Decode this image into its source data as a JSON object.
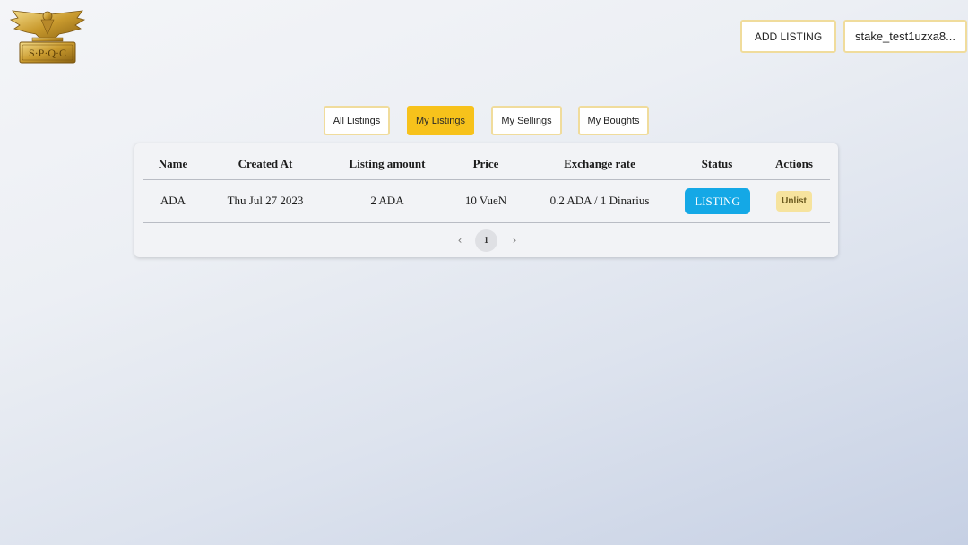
{
  "header": {
    "logo_text": "S·P·Q·C",
    "add_listing_label": "ADD LISTING",
    "wallet_label": "stake_test1uzxa8..."
  },
  "tabs": [
    {
      "label": "All Listings",
      "active": false
    },
    {
      "label": "My Listings",
      "active": true
    },
    {
      "label": "My Sellings",
      "active": false
    },
    {
      "label": "My Boughts",
      "active": false
    }
  ],
  "table": {
    "columns": [
      "Name",
      "Created At",
      "Listing amount",
      "Price",
      "Exchange rate",
      "Status",
      "Actions"
    ],
    "rows": [
      {
        "name": "ADA",
        "created_at": "Thu Jul 27 2023",
        "listing_amount": "2 ADA",
        "price": "10 VueN",
        "exchange_rate": "0.2 ADA / 1 Dinarius",
        "status": "LISTING",
        "action": "Unlist"
      }
    ]
  },
  "pagination": {
    "prev_icon": "chevron-left-icon",
    "next_icon": "chevron-right-icon",
    "current_page": "1"
  },
  "colors": {
    "accent": "#f7c21b",
    "border": "#f0dc9c",
    "status": "#14a8e6",
    "unlist": "#f6e39e"
  }
}
